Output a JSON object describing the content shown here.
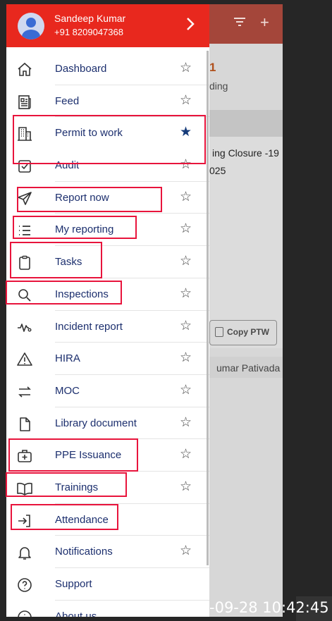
{
  "user": {
    "name": "Sandeep Kumar",
    "phone": "+91 8209047368"
  },
  "background": {
    "red_text": "1",
    "status_fragment": "ding",
    "card_title_fragment": "ing Closure -19",
    "card_date_fragment": "025",
    "copy_button": "Copy PTW",
    "person_fragment": "umar Pativada"
  },
  "menu": [
    {
      "label": "Dashboard",
      "icon": "home-icon",
      "favorite": false,
      "star": "☆"
    },
    {
      "label": "Feed",
      "icon": "newspaper-icon",
      "favorite": false,
      "star": "☆"
    },
    {
      "label": "Permit to work",
      "icon": "building-icon",
      "favorite": true,
      "star": "★"
    },
    {
      "label": "Audit",
      "icon": "checkbox-icon",
      "favorite": false,
      "star": "☆"
    },
    {
      "label": "Report now",
      "icon": "send-icon",
      "favorite": false,
      "star": "☆"
    },
    {
      "label": "My reporting",
      "icon": "list-icon",
      "favorite": false,
      "star": "☆"
    },
    {
      "label": "Tasks",
      "icon": "clipboard-icon",
      "favorite": false,
      "star": "☆"
    },
    {
      "label": "Inspections",
      "icon": "search-icon",
      "favorite": false,
      "star": "☆"
    },
    {
      "label": "Incident report",
      "icon": "pulse-icon",
      "favorite": false,
      "star": "☆"
    },
    {
      "label": "HIRA",
      "icon": "warning-icon",
      "favorite": false,
      "star": "☆"
    },
    {
      "label": "MOC",
      "icon": "swap-icon",
      "favorite": false,
      "star": "☆"
    },
    {
      "label": "Library document",
      "icon": "document-icon",
      "favorite": false,
      "star": "☆"
    },
    {
      "label": "PPE Issuance",
      "icon": "medkit-icon",
      "favorite": false,
      "star": "☆"
    },
    {
      "label": "Trainings",
      "icon": "book-icon",
      "favorite": false,
      "star": "☆"
    },
    {
      "label": "Attendance",
      "icon": "login-icon",
      "favorite": false,
      "star": ""
    },
    {
      "label": "Notifications",
      "icon": "bell-icon",
      "favorite": false,
      "star": "☆"
    },
    {
      "label": "Support",
      "icon": "help-icon",
      "favorite": false,
      "star": ""
    },
    {
      "label": "About us",
      "icon": "info-icon",
      "favorite": false,
      "star": ""
    }
  ],
  "highlighted_items": [
    "Permit to work",
    "Report now",
    "My reporting",
    "Tasks",
    "Inspections",
    "PPE Issuance",
    "Trainings",
    "Attendance"
  ],
  "timestamp": "-09-28 10:42:45",
  "colors": {
    "header": "#e8281e",
    "highlight": "#e8143c",
    "label": "#1c2f6e"
  }
}
